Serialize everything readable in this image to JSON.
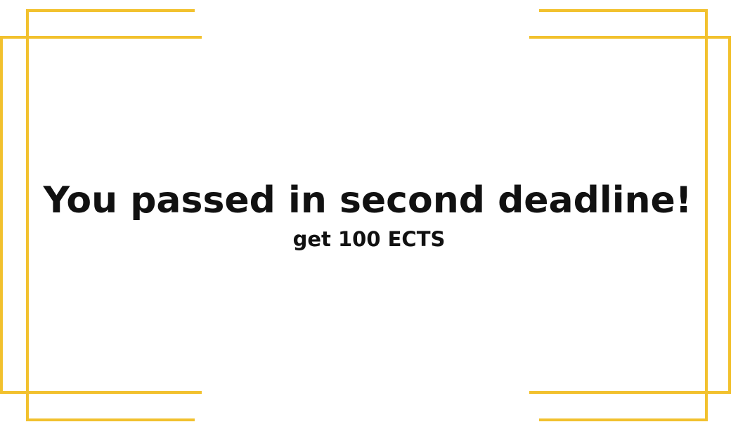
{
  "message": {
    "headline": "You passed in second deadline!",
    "subline": "get 100 ECTS"
  },
  "colors": {
    "frame": "#f2c12e",
    "text": "#111111",
    "background": "#ffffff"
  }
}
